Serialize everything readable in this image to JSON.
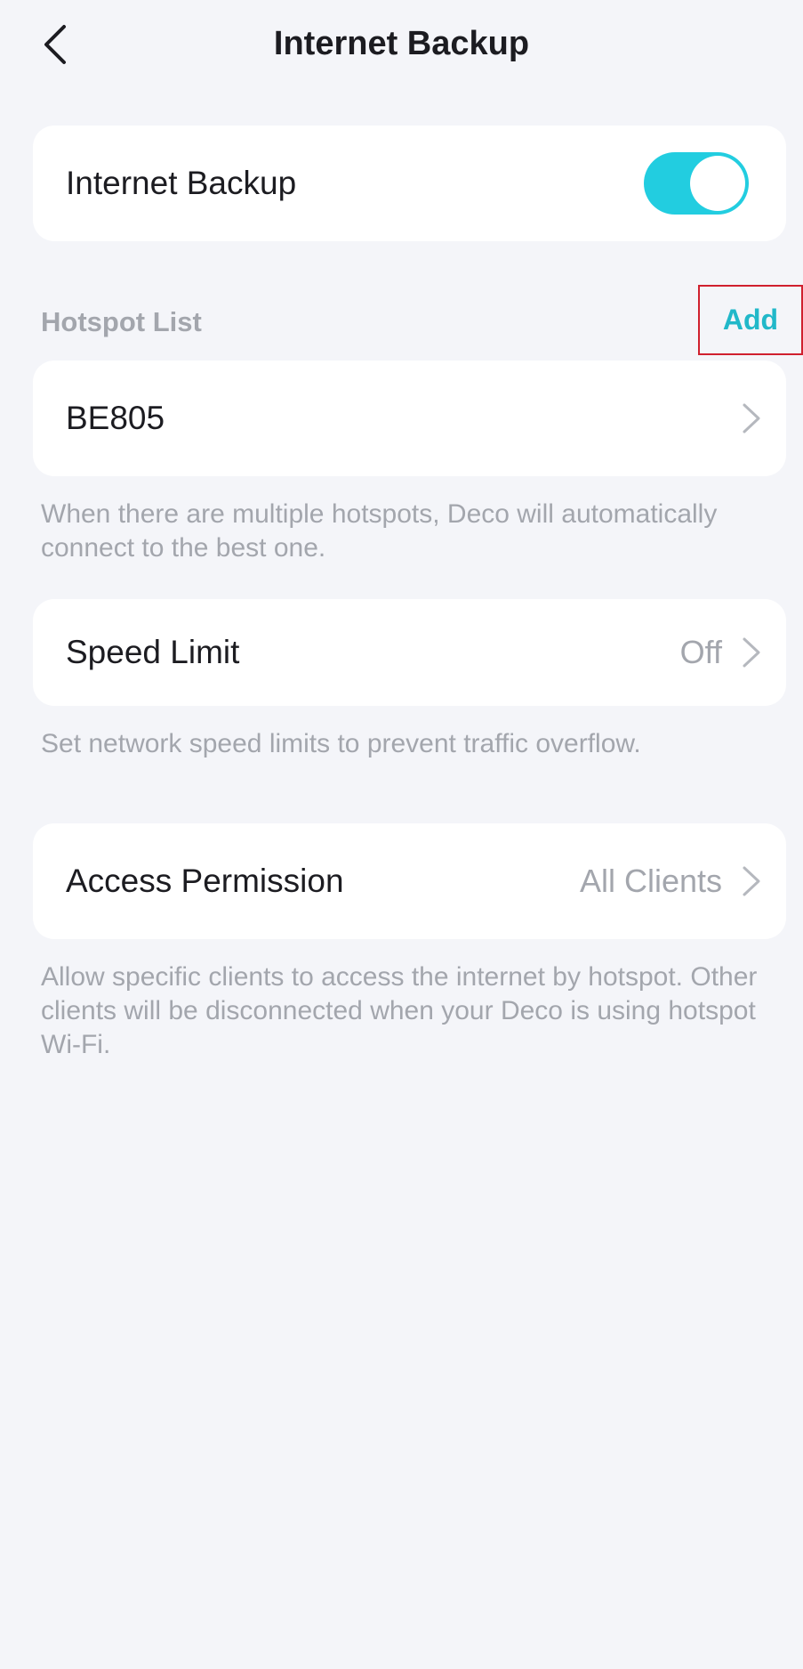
{
  "header": {
    "title": "Internet Backup",
    "back_icon": "chevron-left-icon"
  },
  "internet_backup": {
    "label": "Internet Backup",
    "enabled": true,
    "toggle_color": "#22cde0"
  },
  "hotspot_list": {
    "section_label": "Hotspot List",
    "add_label": "Add",
    "items": [
      {
        "name": "BE805"
      }
    ],
    "help": "When there are multiple hotspots, Deco will automatically connect to the best one."
  },
  "speed_limit": {
    "label": "Speed Limit",
    "value": "Off",
    "help": "Set network speed limits to prevent traffic overflow."
  },
  "access_permission": {
    "label": "Access Permission",
    "value": "All Clients",
    "help": "Allow specific clients to access the internet by hotspot. Other clients will be disconnected when your Deco is using hotspot Wi-Fi."
  },
  "colors": {
    "background": "#f4f5f9",
    "accent": "#21b8c9",
    "secondary_text": "#a3a6ad"
  }
}
